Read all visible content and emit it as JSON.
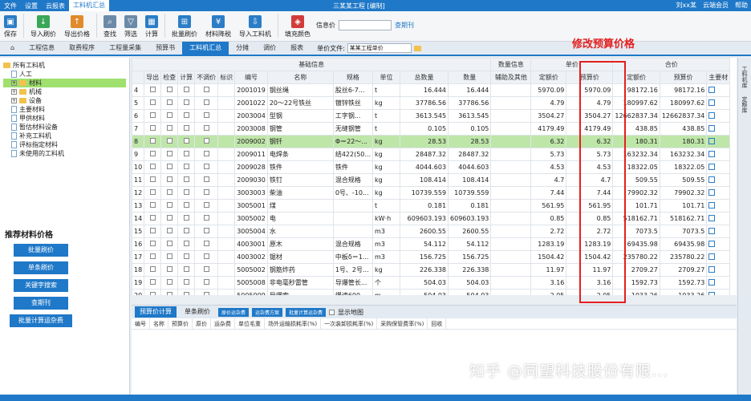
{
  "menu": {
    "items": [
      "文件",
      "设置",
      "云报表",
      "工料机汇总"
    ],
    "active": 3,
    "title": "三某某工程 [编制]",
    "right": [
      "刘xx某",
      "云端会员",
      "帮助"
    ]
  },
  "toolbar": {
    "buttons": [
      "保存",
      "导入刷价",
      "导出价格",
      "查找",
      "筛选",
      "计算",
      "批量刷价",
      "材料降税",
      "导入工料机",
      "填充颜色"
    ],
    "field_label": "信息价",
    "field_action": "查期刊"
  },
  "tabs": [
    "工程信息",
    "取费程序",
    "工程量采集",
    "预算书",
    "工料机汇总",
    "分摊",
    "调价",
    "报表"
  ],
  "active_tab": 4,
  "unit_file": {
    "label": "单价文件:",
    "value": "某某工程单价"
  },
  "tree": [
    {
      "label": "所有工料机",
      "type": "folder",
      "indent": 0
    },
    {
      "label": "人工",
      "type": "doc",
      "indent": 1
    },
    {
      "label": "材料",
      "type": "folder",
      "indent": 1,
      "selected": true
    },
    {
      "label": "机械",
      "type": "folder",
      "indent": 1
    },
    {
      "label": "设备",
      "type": "folder",
      "indent": 1
    },
    {
      "label": "主要材料",
      "type": "doc",
      "indent": 1
    },
    {
      "label": "甲供材料",
      "type": "doc",
      "indent": 1
    },
    {
      "label": "暂估材料设备",
      "type": "doc",
      "indent": 1
    },
    {
      "label": "补充工料机",
      "type": "doc",
      "indent": 1
    },
    {
      "label": "评标指定材料",
      "type": "doc",
      "indent": 1
    },
    {
      "label": "未使用的工料机",
      "type": "doc",
      "indent": 1
    }
  ],
  "recommend": {
    "title": "推荐材料价格",
    "buttons": [
      "批量刷价",
      "单条刷价",
      "关键字搜索",
      "查期刊",
      "批量计算运杂费"
    ]
  },
  "grid": {
    "groups": [
      "基础信息",
      "数量信息",
      "单价",
      "合价"
    ],
    "headers": [
      "",
      "导出",
      "检查",
      "计算",
      "不调价",
      "标识",
      "编号",
      "名称",
      "规格",
      "单位",
      "总数量",
      "数量",
      "辅助及其他",
      "定额价",
      "预算价",
      "定额价",
      "预算价",
      "主要材"
    ],
    "rows": [
      {
        "no": "4",
        "code": "2001019",
        "name": "钢丝绳",
        "spec": "股丝6-7...",
        "unit": "t",
        "total": "16.444",
        "qty": "16.444",
        "dj": "5970.09",
        "yj": "5970.09",
        "hdj": "98172.16",
        "hyj": "98172.16"
      },
      {
        "no": "5",
        "code": "2001022",
        "name": "20～22号铁丝",
        "spec": "镀锌铁丝",
        "unit": "kg",
        "total": "37786.56",
        "qty": "37786.56",
        "dj": "4.79",
        "yj": "4.79",
        "hdj": "180997.62",
        "hyj": "180997.62"
      },
      {
        "no": "6",
        "code": "2003004",
        "name": "型钢",
        "spec": "工字钢...",
        "unit": "t",
        "total": "3613.545",
        "qty": "3613.545",
        "dj": "3504.27",
        "yj": "3504.27",
        "hdj": "12662837.34",
        "hyj": "12662837.34"
      },
      {
        "no": "7",
        "code": "2003008",
        "name": "钢管",
        "spec": "无缝钢管",
        "unit": "t",
        "total": "0.105",
        "qty": "0.105",
        "dj": "4179.49",
        "yj": "4179.49",
        "hdj": "438.85",
        "hyj": "438.85"
      },
      {
        "no": "8",
        "code": "2009002",
        "name": "钢钎",
        "spec": "Φ＝22～...",
        "unit": "kg",
        "total": "28.53",
        "qty": "28.53",
        "dj": "6.32",
        "yj": "6.32",
        "hdj": "180.31",
        "hyj": "180.31",
        "hl": true
      },
      {
        "no": "9",
        "code": "2009011",
        "name": "电焊条",
        "spec": "结422(50...",
        "unit": "kg",
        "total": "28487.32",
        "qty": "28487.32",
        "dj": "5.73",
        "yj": "5.73",
        "hdj": "163232.34",
        "hyj": "163232.34"
      },
      {
        "no": "10",
        "code": "2009028",
        "name": "铁件",
        "spec": "铁件",
        "unit": "kg",
        "total": "4044.603",
        "qty": "4044.603",
        "dj": "4.53",
        "yj": "4.53",
        "hdj": "18322.05",
        "hyj": "18322.05"
      },
      {
        "no": "11",
        "code": "2009030",
        "name": "铁钉",
        "spec": "混合规格",
        "unit": "kg",
        "total": "108.414",
        "qty": "108.414",
        "dj": "4.7",
        "yj": "4.7",
        "hdj": "509.55",
        "hyj": "509.55"
      },
      {
        "no": "12",
        "code": "3003003",
        "name": "柴油",
        "spec": "0号、-10...",
        "unit": "kg",
        "total": "10739.559",
        "qty": "10739.559",
        "dj": "7.44",
        "yj": "7.44",
        "hdj": "79902.32",
        "hyj": "79902.32"
      },
      {
        "no": "13",
        "code": "3005001",
        "name": "煤",
        "spec": "",
        "unit": "t",
        "total": "0.181",
        "qty": "0.181",
        "dj": "561.95",
        "yj": "561.95",
        "hdj": "101.71",
        "hyj": "101.71"
      },
      {
        "no": "14",
        "code": "3005002",
        "name": "电",
        "spec": "",
        "unit": "kW·h",
        "total": "609603.193",
        "qty": "609603.193",
        "dj": "0.85",
        "yj": "0.85",
        "hdj": "518162.71",
        "hyj": "518162.71"
      },
      {
        "no": "15",
        "code": "3005004",
        "name": "水",
        "spec": "",
        "unit": "m3",
        "total": "2600.55",
        "qty": "2600.55",
        "dj": "2.72",
        "yj": "2.72",
        "hdj": "7073.5",
        "hyj": "7073.5"
      },
      {
        "no": "16",
        "code": "4003001",
        "name": "原木",
        "spec": "混合规格",
        "unit": "m3",
        "total": "54.112",
        "qty": "54.112",
        "dj": "1283.19",
        "yj": "1283.19",
        "hdj": "69435.98",
        "hyj": "69435.98"
      },
      {
        "no": "17",
        "code": "4003002",
        "name": "锯材",
        "spec": "中板δ＝1...",
        "unit": "m3",
        "total": "156.725",
        "qty": "156.725",
        "dj": "1504.42",
        "yj": "1504.42",
        "hdj": "235780.22",
        "hyj": "235780.22"
      },
      {
        "no": "18",
        "code": "5005002",
        "name": "钢筋炸药",
        "spec": "1号、2号...",
        "unit": "kg",
        "total": "226.338",
        "qty": "226.338",
        "dj": "11.97",
        "yj": "11.97",
        "hdj": "2709.27",
        "hyj": "2709.27"
      },
      {
        "no": "19",
        "code": "5005008",
        "name": "非电毫秒雷管",
        "spec": "导爆管长...",
        "unit": "个",
        "total": "504.03",
        "qty": "504.03",
        "dj": "3.16",
        "yj": "3.16",
        "hdj": "1592.73",
        "hyj": "1592.73"
      },
      {
        "no": "20",
        "code": "5005009",
        "name": "导爆索",
        "spec": "爆速600...",
        "unit": "m",
        "total": "504.03",
        "qty": "504.03",
        "dj": "2.05",
        "yj": "2.05",
        "hdj": "1033.26",
        "hyj": "1033.26"
      }
    ]
  },
  "bottom": {
    "tabs": [
      "预算价计算",
      "单条刷价"
    ],
    "buttons": [
      "原价运杂费",
      "运杂费方案",
      "批量计算运杂费"
    ],
    "show_map": "显示地图",
    "headers": [
      "编号",
      "名称",
      "预算价",
      "原价",
      "运杂费",
      "单位毛重",
      "场外运输损耗率(%)",
      "一次装卸损耗率(%)",
      "采购保管费率(%)",
      "回收"
    ]
  },
  "right_strip": [
    "工料机库",
    "定额库"
  ],
  "annotation": "修改预算价格",
  "watermark": "知乎 @同望科技股份有限..."
}
